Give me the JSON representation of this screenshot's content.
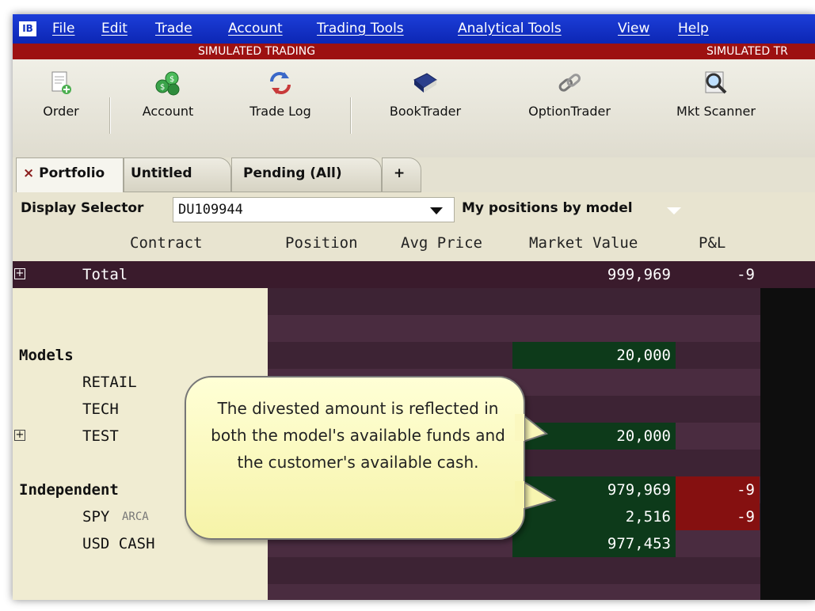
{
  "menu": {
    "logo": "IB",
    "items": [
      "File",
      "Edit",
      "Trade",
      "Account",
      "Trading Tools",
      "Analytical Tools",
      "View",
      "Help"
    ]
  },
  "banner": {
    "text_left": "SIMULATED TRADING",
    "text_right": "SIMULATED TR"
  },
  "toolbar": {
    "order": "Order",
    "account": "Account",
    "trade_log": "Trade Log",
    "booktrader": "BookTrader",
    "optiontrader": "OptionTrader",
    "mkt_scanner": "Mkt Scanner"
  },
  "tabs": {
    "close_glyph": "×",
    "portfolio": "Portfolio",
    "untitled": "Untitled",
    "pending": "Pending (All)",
    "add": "+"
  },
  "selector": {
    "label": "Display Selector",
    "value": "DU109944",
    "view": "My positions by model"
  },
  "columns": {
    "contract": "Contract",
    "position": "Position",
    "avg_price": "Avg Price",
    "market_value": "Market Value",
    "pl": "P&L"
  },
  "rows": {
    "total": {
      "label": "Total",
      "market_value": "999,969",
      "pl": "-9"
    },
    "models": {
      "label": "Models",
      "market_value": "20,000"
    },
    "retail": {
      "label": "RETAIL"
    },
    "tech": {
      "label": "TECH"
    },
    "test": {
      "label": "TEST",
      "market_value": "20,000"
    },
    "independent": {
      "label": "Independent",
      "market_value": "979,969",
      "pl": "-9"
    },
    "spy": {
      "label": "SPY",
      "exchange": "ARCA",
      "market_value": "2,516",
      "pl": "-9"
    },
    "usd_cash": {
      "label": "USD CASH",
      "market_value": "977,453"
    }
  },
  "callout": {
    "text": "The divested amount is reflected in both the model's available funds and the customer's available cash."
  },
  "colors": {
    "menu_blue": "#1a3cd6",
    "sim_red": "#9d1111",
    "grid_dark": "#3a1b2c",
    "positive_green": "#0d3a1a",
    "negative_red": "#851010",
    "callout_yellow": "#fbf8c2"
  }
}
